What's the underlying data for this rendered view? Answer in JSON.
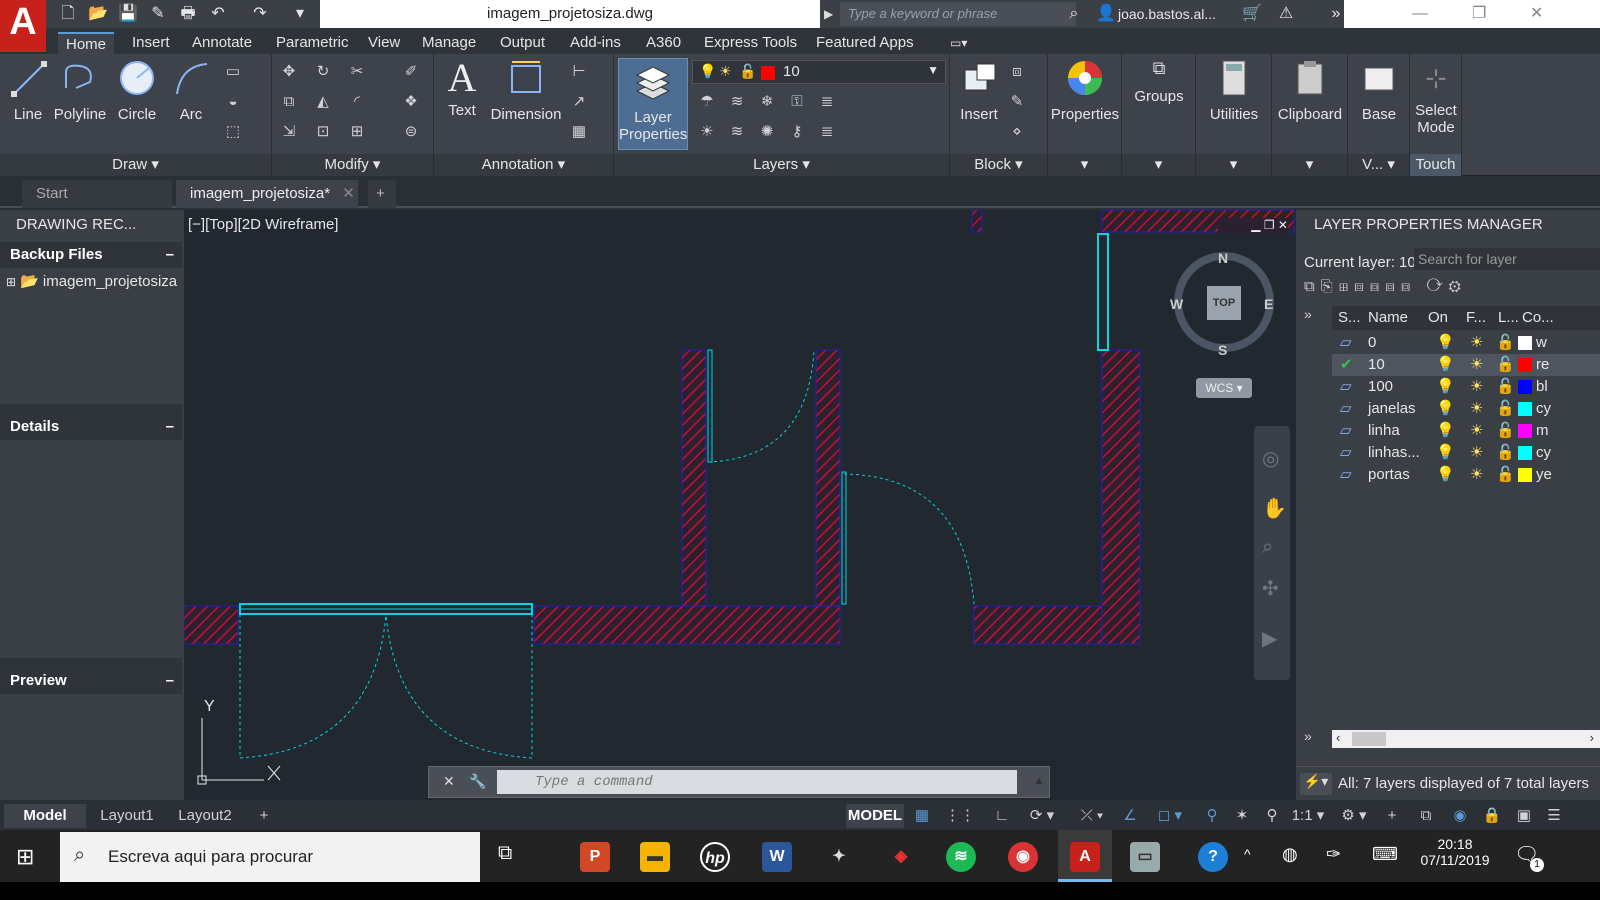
{
  "app": {
    "menu_letter": "A",
    "file_title": "imagem_projetosiza.dwg",
    "search_placeholder": "Type a keyword or phrase",
    "user": "joao.bastos.al..."
  },
  "ribbon_tabs": [
    "Home",
    "Insert",
    "Annotate",
    "Parametric",
    "View",
    "Manage",
    "Output",
    "Add-ins",
    "A360",
    "Express Tools",
    "Featured Apps"
  ],
  "ribbon": {
    "draw": {
      "label": "Draw",
      "line": "Line",
      "polyline": "Polyline",
      "circle": "Circle",
      "arc": "Arc"
    },
    "modify": {
      "label": "Modify"
    },
    "annotation": {
      "label": "Annotation",
      "text": "Text",
      "dimension": "Dimension"
    },
    "layers": {
      "label": "Layers",
      "layer_properties_1": "Layer",
      "layer_properties_2": "Properties",
      "current_layer": "10"
    },
    "block": {
      "label": "Block",
      "insert": "Insert"
    },
    "properties": "Properties",
    "groups": "Groups",
    "utilities": "Utilities",
    "clipboard": "Clipboard",
    "view": {
      "base": "Base",
      "label": "V..."
    },
    "touch": {
      "select_mode_1": "Select",
      "select_mode_2": "Mode",
      "label": "Touch"
    }
  },
  "doc_tabs": {
    "start": "Start",
    "active": "imagem_projetosiza*"
  },
  "left_panel": {
    "title": "DRAWING REC...",
    "backup_header": "Backup Files",
    "backup_file": "imagem_projetosiza",
    "details_header": "Details",
    "preview_header": "Preview"
  },
  "viewport": {
    "label": "[−][Top][2D Wireframe]",
    "compass": {
      "n": "N",
      "s": "S",
      "e": "E",
      "w": "W",
      "top": "TOP"
    },
    "wcs": "WCS",
    "ucs_y": "Y",
    "command_placeholder": "Type  a  command"
  },
  "layer_manager": {
    "title": "LAYER PROPERTIES MANAGER",
    "current_layer": "Current layer: 10",
    "search_placeholder": "Search for layer",
    "columns": [
      "S...",
      "Name",
      "On",
      "F...",
      "L...",
      "Co..."
    ],
    "layers": [
      {
        "name": "0",
        "color": "#ffffff",
        "color_label": "w"
      },
      {
        "name": "10",
        "color": "#ff0000",
        "color_label": "re",
        "current": true
      },
      {
        "name": "100",
        "color": "#0000ff",
        "color_label": "bl"
      },
      {
        "name": "janelas",
        "color": "#00ffff",
        "color_label": "cy"
      },
      {
        "name": "linha",
        "color": "#ff00ff",
        "color_label": "m"
      },
      {
        "name": "linhas...",
        "color": "#00ffff",
        "color_label": "cy"
      },
      {
        "name": "portas",
        "color": "#ffff00",
        "color_label": "ye"
      }
    ],
    "status": "All: 7 layers displayed of 7 total layers"
  },
  "layout_tabs": [
    "Model",
    "Layout1",
    "Layout2"
  ],
  "status": {
    "model": "MODEL",
    "scale": "1:1"
  },
  "taskbar": {
    "search": "Escreva aqui para procurar",
    "time": "20:18",
    "date": "07/11/2019",
    "notifications": "1"
  },
  "colors": {
    "wall_hatch": "#c8102e",
    "door_window": "#00d8e0",
    "accent": "#5b9bd5"
  }
}
